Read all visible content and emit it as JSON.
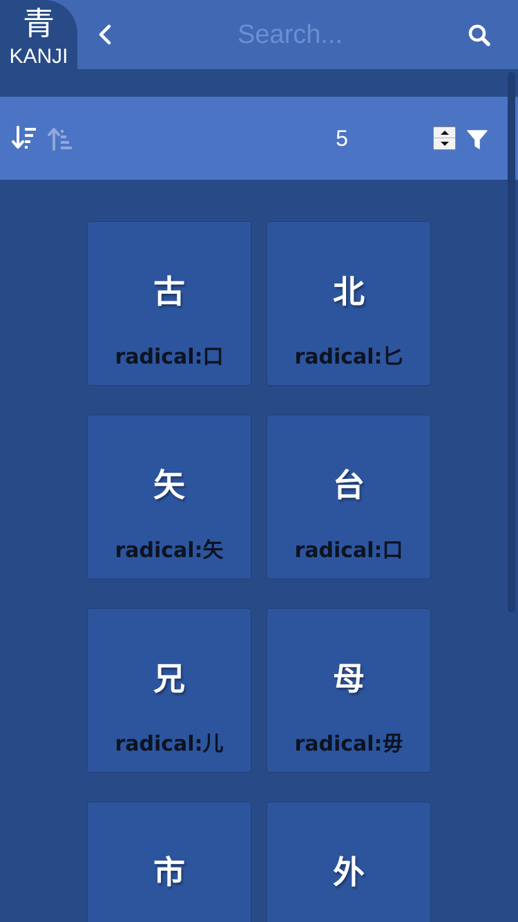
{
  "header": {
    "logo_kanji": "青",
    "logo_text": "KANJI",
    "search_placeholder": "Search..."
  },
  "toolbar": {
    "level_value": "5"
  },
  "icons": {
    "back": "chevron-left-icon",
    "search": "search-icon",
    "sort_desc": "sort-descending-icon",
    "sort_asc": "sort-ascending-icon",
    "spinner": "number-spinner-icon",
    "filter": "filter-icon"
  },
  "colors": {
    "header": "#4169b3",
    "toolbar": "#4b74c4",
    "background": "#284b87",
    "card": "#2d559e",
    "placeholder": "#6a8fd2"
  },
  "cards": [
    {
      "kanji": "古",
      "radical": "radical:口"
    },
    {
      "kanji": "北",
      "radical": "radical:匕"
    },
    {
      "kanji": "矢",
      "radical": "radical:矢"
    },
    {
      "kanji": "台",
      "radical": "radical:口"
    },
    {
      "kanji": "兄",
      "radical": "radical:儿"
    },
    {
      "kanji": "母",
      "radical": "radical:毋"
    },
    {
      "kanji": "市",
      "radical": ""
    },
    {
      "kanji": "外",
      "radical": ""
    }
  ]
}
